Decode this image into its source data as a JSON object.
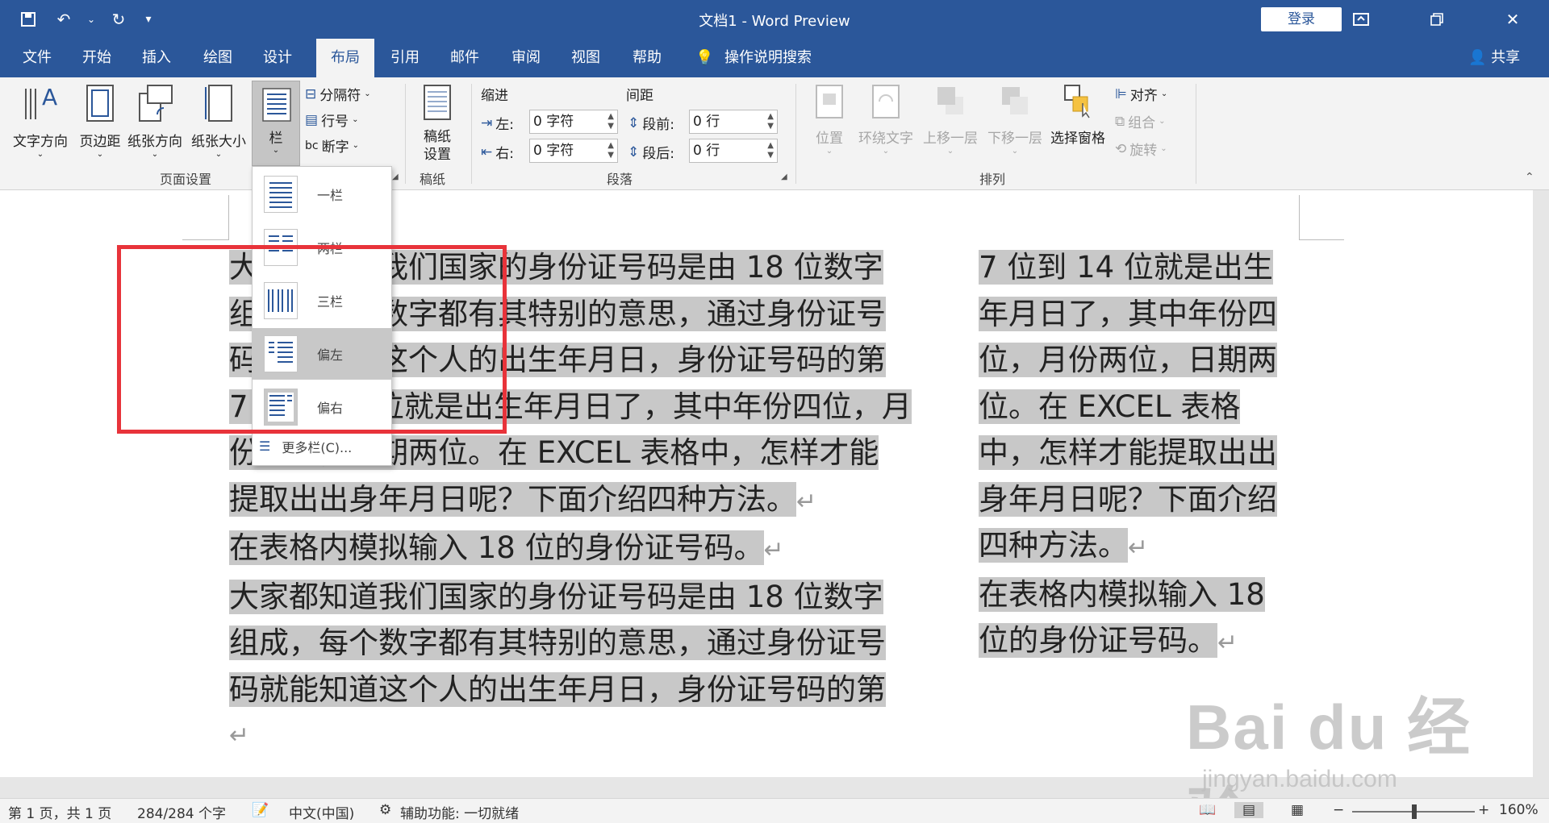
{
  "app": {
    "title": "文档1 - Word Preview",
    "signin_label": "登录",
    "share_label": "共享"
  },
  "tabs": [
    {
      "label": "文件"
    },
    {
      "label": "开始"
    },
    {
      "label": "插入"
    },
    {
      "label": "绘图"
    },
    {
      "label": "设计"
    },
    {
      "label": "布局"
    },
    {
      "label": "引用"
    },
    {
      "label": "邮件"
    },
    {
      "label": "审阅"
    },
    {
      "label": "视图"
    },
    {
      "label": "帮助"
    },
    {
      "label": "操作说明搜索"
    }
  ],
  "active_tab": "布局",
  "ribbon": {
    "page_setup": {
      "text_direction": "文字方向",
      "margins": "页边距",
      "orientation": "纸张方向",
      "size": "纸张大小",
      "columns": "栏",
      "breaks": "分隔符",
      "line_numbers": "行号",
      "hyphenation": "断字",
      "group_label": "页面设置"
    },
    "draft": {
      "button": "稿纸设置",
      "group_label": "稿纸"
    },
    "paragraph": {
      "indent_label": "缩进",
      "spacing_label": "间距",
      "left_label": "左:",
      "left_value": "0 字符",
      "right_label": "右:",
      "right_value": "0 字符",
      "before_label": "段前:",
      "before_value": "0 行",
      "after_label": "段后:",
      "after_value": "0 行",
      "group_label": "段落"
    },
    "arrange": {
      "position": "位置",
      "wrap_text": "环绕文字",
      "bring_forward": "上移一层",
      "send_backward": "下移一层",
      "selection_pane": "选择窗格",
      "align": "对齐",
      "group": "组合",
      "rotate": "旋转",
      "group_label": "排列"
    }
  },
  "columns_menu": {
    "items": [
      {
        "label": "一栏"
      },
      {
        "label": "两栏"
      },
      {
        "label": "三栏"
      },
      {
        "label": "偏左"
      },
      {
        "label": "偏右"
      }
    ],
    "more": "更多栏(C)..."
  },
  "document": {
    "left_column": [
      "大家都知道我们国家的身份证号码是由 18 位数字",
      "组成，每个数字都有其特别的意思，通过身份证号",
      "码就能知道这个人的出生年月日，身份证号码的第",
      "7 位到 14 位就是出生年月日了，其中年份四位，月",
      "份两位，日期两位。在 EXCEL 表格中，怎样才能",
      "提取出出身年月日呢？下面介绍四种方法。",
      "在表格内模拟输入 18 位的身份证号码。",
      "大家都知道我们国家的身份证号码是由 18 位数字",
      "组成，每个数字都有其特别的意思，通过身份证号",
      "码就能知道这个人的出生年月日，身份证号码的第"
    ],
    "right_column": [
      "7 位到 14 位就是出生",
      "年月日了，其中年份四",
      "位，月份两位，日期两",
      "位。在 EXCEL 表格",
      "中，怎样才能提取出出",
      "身年月日呢？下面介绍",
      "四种方法。",
      "在表格内模拟输入 18",
      "位的身份证号码。"
    ],
    "paragraph_mark": "↵"
  },
  "status": {
    "page": "第 1 页，共 1 页",
    "words": "284/284 个字",
    "language": "中文(中国)",
    "accessibility": "辅助功能: 一切就绪",
    "zoom": "160%"
  },
  "watermark": {
    "main": "Bai du 经验",
    "sub": "jingyan.baidu.com"
  },
  "colors": {
    "brand": "#2b579a",
    "highlight": "#c8c8c8",
    "callout": "#e8333a"
  }
}
